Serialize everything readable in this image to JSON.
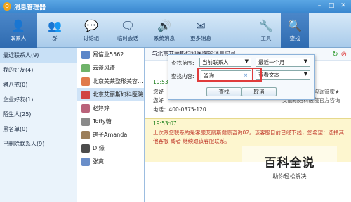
{
  "window": {
    "title": "消息管理器",
    "logo_glyph": "Q",
    "minimize": "–",
    "maximize": "□",
    "close": "✕"
  },
  "toolbar": {
    "items": [
      {
        "label": "联系人",
        "icon": "person-icon",
        "glyph": "👤",
        "active": true
      },
      {
        "label": "群",
        "icon": "group-icon",
        "glyph": "👥"
      },
      {
        "label": "讨论组",
        "icon": "discussion-icon",
        "glyph": "💬"
      },
      {
        "label": "临时会话",
        "icon": "temp-chat-icon",
        "glyph": "🗨"
      },
      {
        "label": "系统消息",
        "icon": "speaker-icon",
        "glyph": "🔊"
      },
      {
        "label": "更多消息",
        "icon": "more-messages-icon",
        "glyph": "✉"
      }
    ],
    "tools_label": "工具",
    "tools_glyph": "🔧",
    "search_label": "查找",
    "search_glyph": "🔍"
  },
  "left_panel": {
    "items": [
      {
        "label": "最近联系人(9)",
        "selected": true
      },
      {
        "label": "我的好友(4)"
      },
      {
        "label": "猪八戒(0)"
      },
      {
        "label": "企业好友(1)"
      },
      {
        "label": "陌生人(25)"
      },
      {
        "label": "黑名单(0)"
      },
      {
        "label": "已删除联系人(9)"
      }
    ]
  },
  "contacts": {
    "items": [
      {
        "name": "易信业5562",
        "color": "#5b86c9"
      },
      {
        "name": "云淡风清",
        "color": "#6fb36a"
      },
      {
        "name": "北京美莱整形美容...",
        "color": "#e07a4b"
      },
      {
        "name": "北京艾丽斯妇科医院",
        "color": "#d14343",
        "selected": true
      },
      {
        "name": "赵婷婷",
        "color": "#b9627a"
      },
      {
        "name": "Toffy糖",
        "color": "#8a8a8a"
      },
      {
        "name": "鸽子Amanda",
        "color": "#9b7e5a"
      },
      {
        "name": "D.缘",
        "color": "#4c4c4c"
      },
      {
        "name": "张爽",
        "color": "#6a8ec9"
      }
    ]
  },
  "chat": {
    "header": "与北京艾丽斯妇科医院的消息记录",
    "refresh_glyph": "↻",
    "stop_glyph": "⊘",
    "time1": "19:53:07",
    "line1": "您好",
    "line2": "您好",
    "line1_right": "冷冻女性健康咨询管家★",
    "line2_right": "艾丽斯妇科医院官方咨询",
    "phone": "电话：400-0375-120",
    "notice_time": "19:53:07",
    "notice_text": "上次跟您联系的是客服艾丽斯健康咨询02。该客服目前已经下线，您希望：选择其他客服 或者 继续跟该客服联系。"
  },
  "search_dialog": {
    "scope_label": "查找范围:",
    "scope_value": "当前联系人",
    "range_value": "最近一个月",
    "content_label": "查找内容:",
    "content_value": "咨询",
    "view_value": "查看文本",
    "clear_glyph": "×",
    "find_button": "查找",
    "cancel_button": "取消",
    "arrow": "▼"
  },
  "watermark": {
    "title": "百科全说",
    "subtitle": "助你轻松解决"
  }
}
